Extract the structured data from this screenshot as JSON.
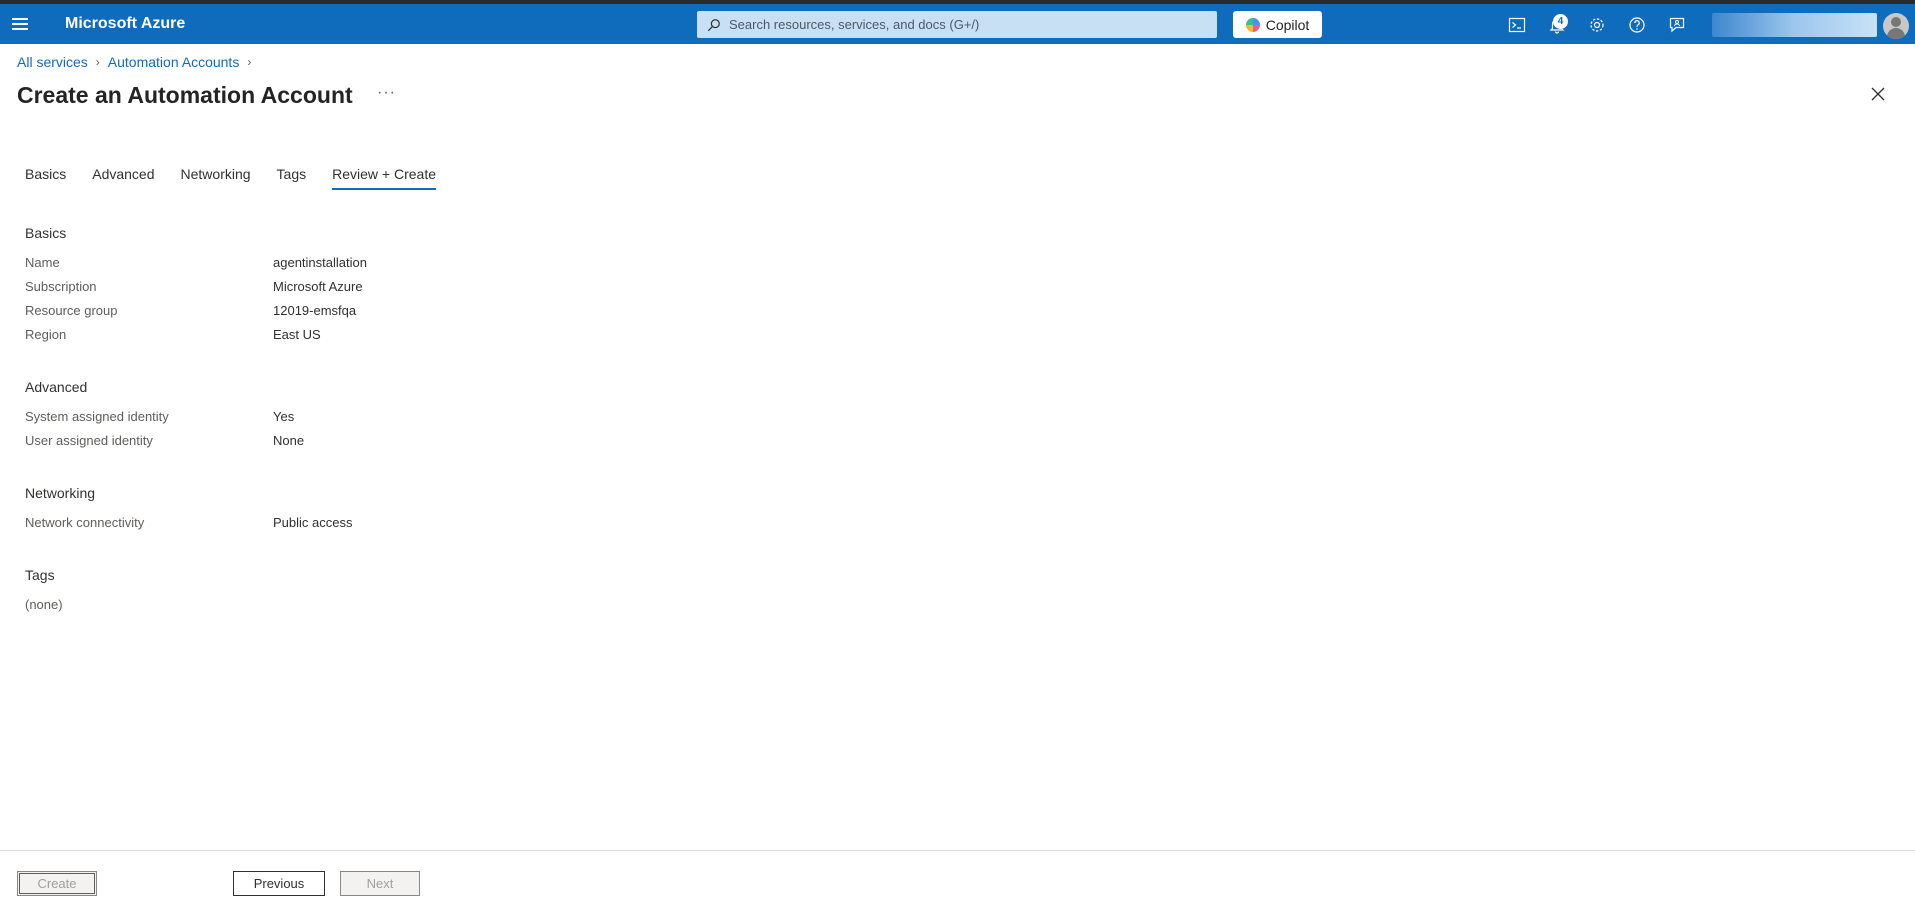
{
  "topbar": {
    "brand": "Microsoft Azure",
    "search_placeholder": "Search resources, services, and docs (G+/)",
    "copilot_label": "Copilot",
    "notification_count": "4",
    "colors": {
      "bar": "#0f6cbd",
      "search_bg": "#c7e0f4"
    },
    "icons": [
      "menu-icon",
      "search-icon",
      "cloud-shell-icon",
      "bell-icon",
      "gear-icon",
      "help-icon",
      "feedback-icon",
      "avatar"
    ]
  },
  "breadcrumb": {
    "items": [
      "All services",
      "Automation Accounts"
    ]
  },
  "page": {
    "title": "Create an Automation Account",
    "more": "···"
  },
  "tabs": [
    "Basics",
    "Advanced",
    "Networking",
    "Tags",
    "Review + Create"
  ],
  "active_tab": "Review + Create",
  "review": {
    "basics": {
      "title": "Basics",
      "rows": [
        {
          "label": "Name",
          "value": "agentinstallation"
        },
        {
          "label": "Subscription",
          "value": "Microsoft Azure"
        },
        {
          "label": "Resource group",
          "value": "12019-emsfqa"
        },
        {
          "label": "Region",
          "value": "East US"
        }
      ]
    },
    "advanced": {
      "title": "Advanced",
      "rows": [
        {
          "label": "System assigned identity",
          "value": "Yes"
        },
        {
          "label": "User assigned identity",
          "value": "None"
        }
      ]
    },
    "networking": {
      "title": "Networking",
      "rows": [
        {
          "label": "Network connectivity",
          "value": "Public access"
        }
      ]
    },
    "tags": {
      "title": "Tags",
      "empty": "(none)"
    }
  },
  "footer": {
    "create_label": "Create",
    "previous_label": "Previous",
    "next_label": "Next"
  }
}
